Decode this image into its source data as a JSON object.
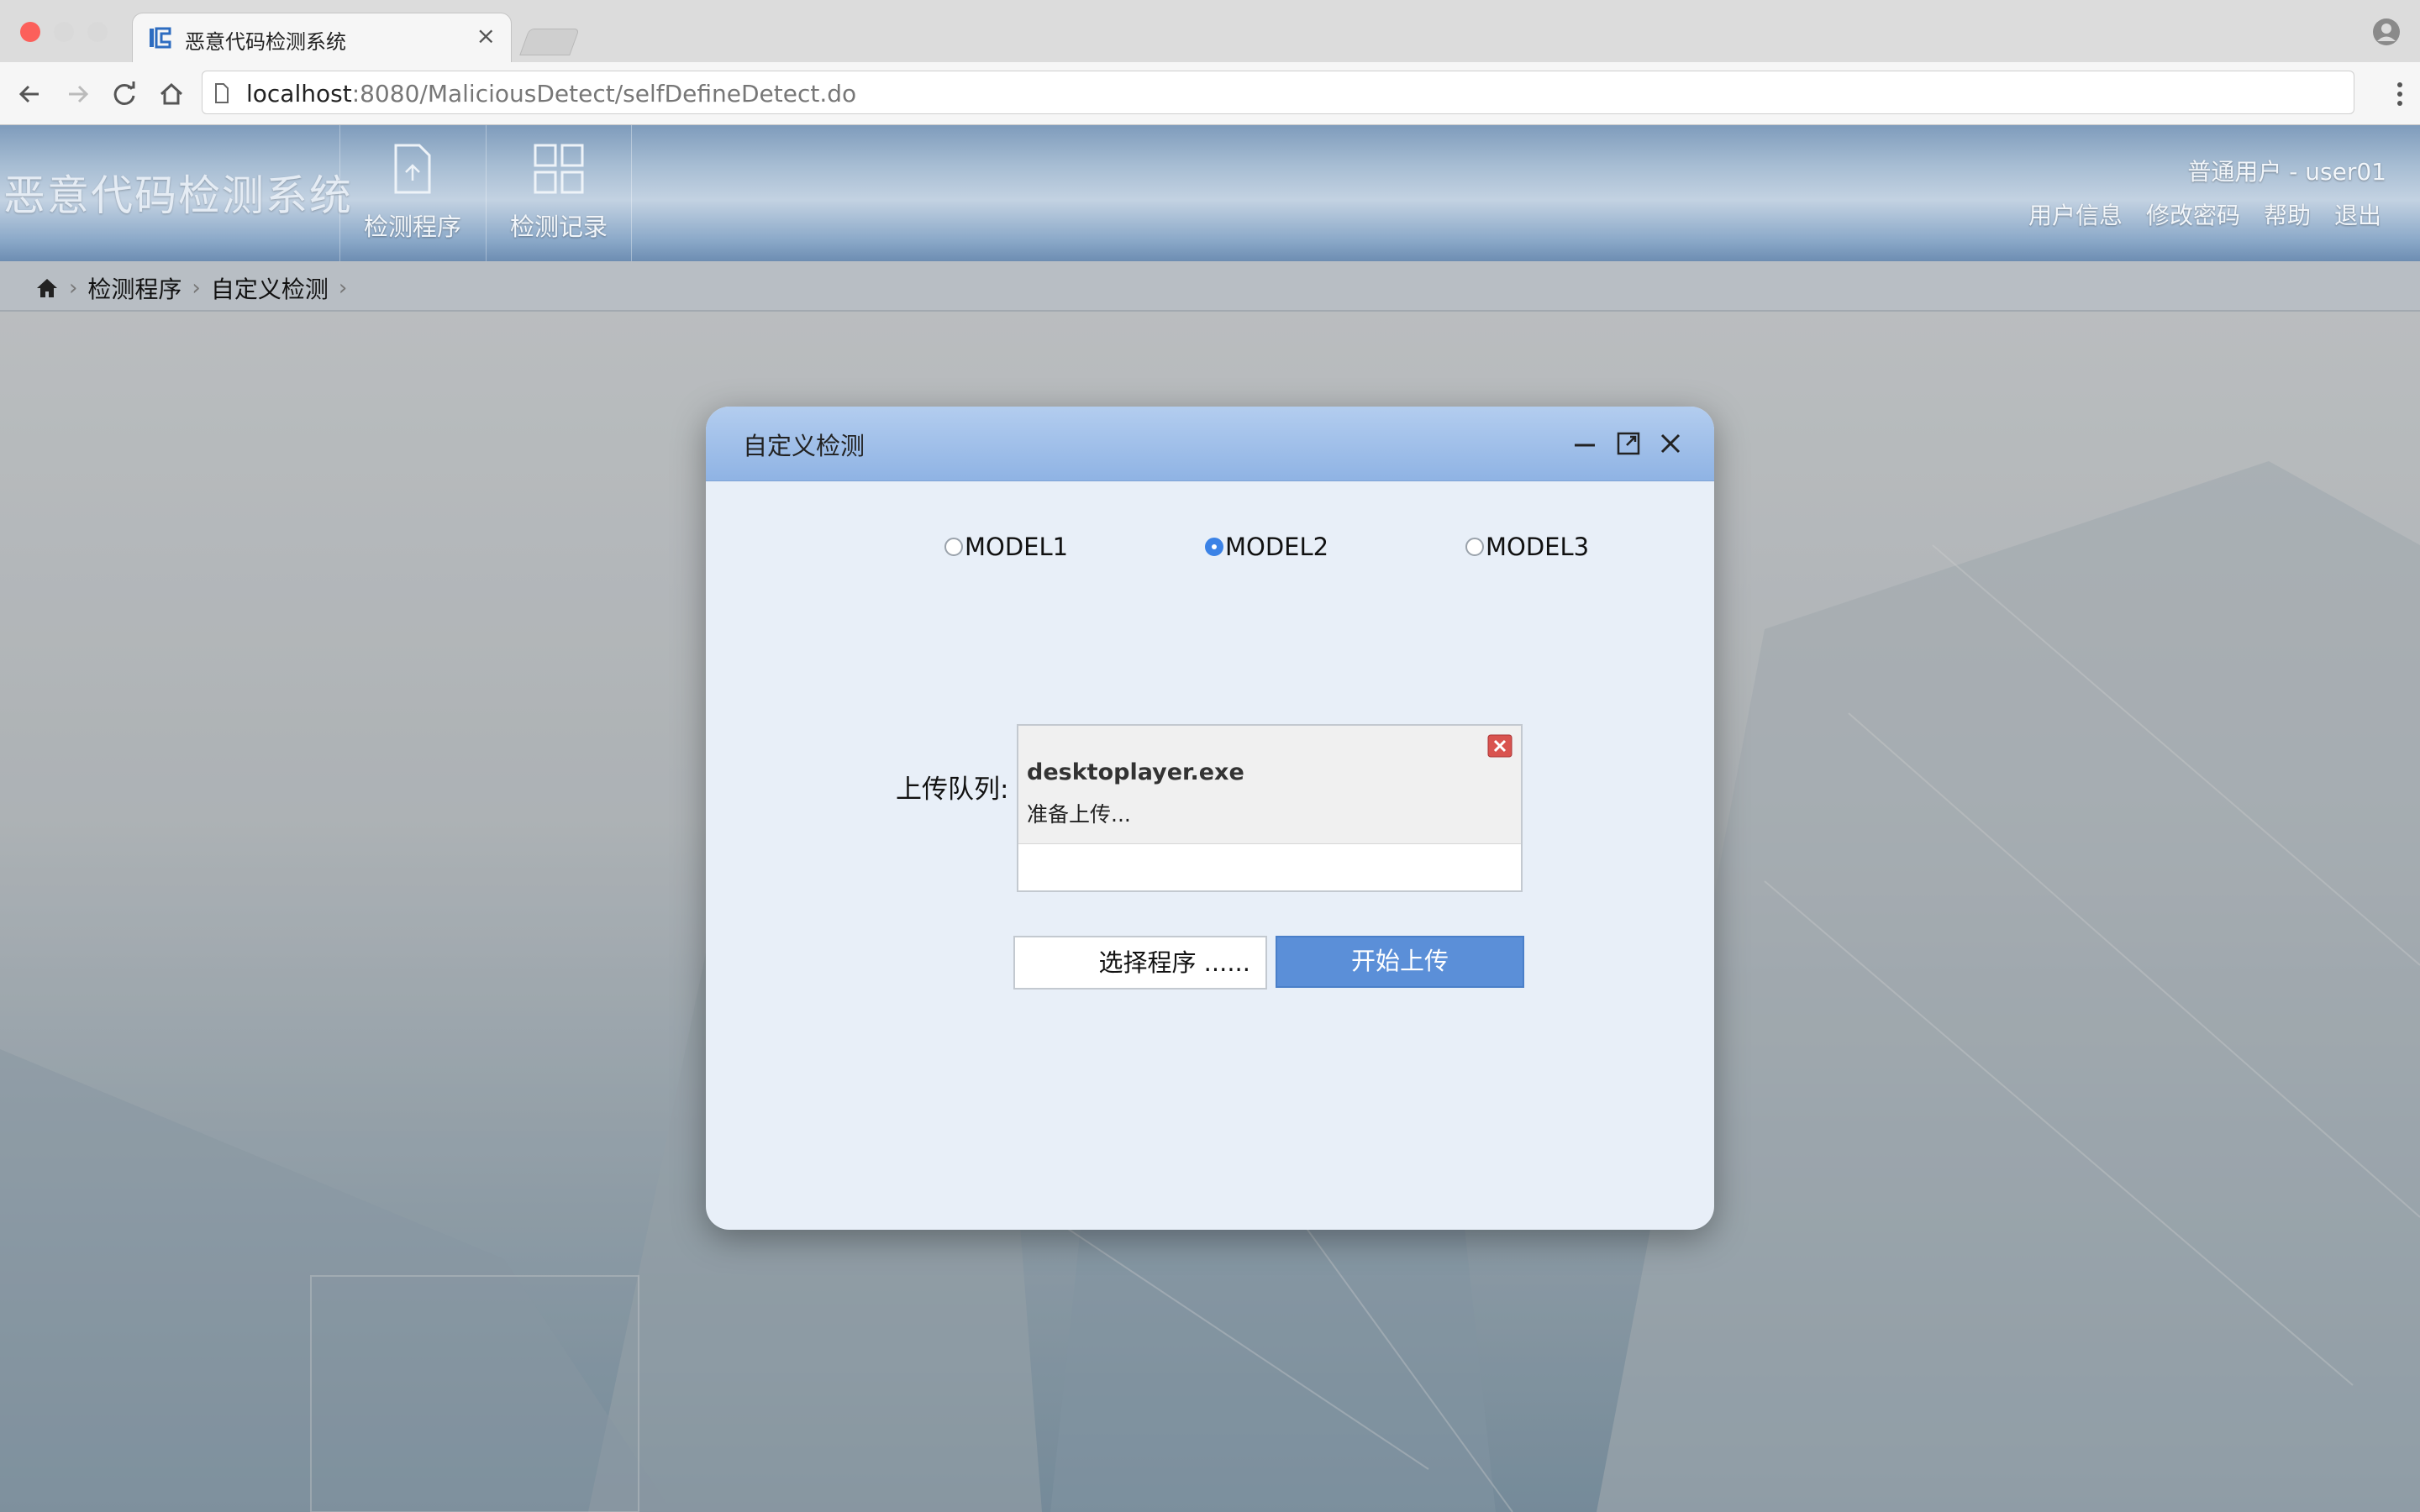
{
  "browser": {
    "tab_title": "恶意代码检测系统",
    "tab_close": "×",
    "url_host": "localhost",
    "url_path": ":8080/MaliciousDetect/selfDefineDetect.do"
  },
  "header": {
    "app_title": "恶意代码检测系统",
    "nav": [
      {
        "label": "检测程序",
        "icon": "document-icon"
      },
      {
        "label": "检测记录",
        "icon": "grid-icon"
      }
    ],
    "user_line": "普通用户 - user01",
    "links": [
      "用户信息",
      "修改密码",
      "帮助",
      "退出"
    ]
  },
  "breadcrumb": {
    "items": [
      "检测程序",
      "自定义检测"
    ],
    "separator": "›"
  },
  "dialog": {
    "title": "自定义检测",
    "models": [
      {
        "label": "MODEL1",
        "checked": false
      },
      {
        "label": "MODEL2",
        "checked": true
      },
      {
        "label": "MODEL3",
        "checked": false
      }
    ],
    "queue_label": "上传队列:",
    "queue": [
      {
        "file": "desktoplayer.exe",
        "status": "准备上传..."
      }
    ],
    "select_button": "选择程序 ......",
    "upload_button": "开始上传"
  },
  "colors": {
    "accent": "#5b8fd8",
    "header_blue": "#8aa8c8",
    "close_red": "#fc605b"
  }
}
